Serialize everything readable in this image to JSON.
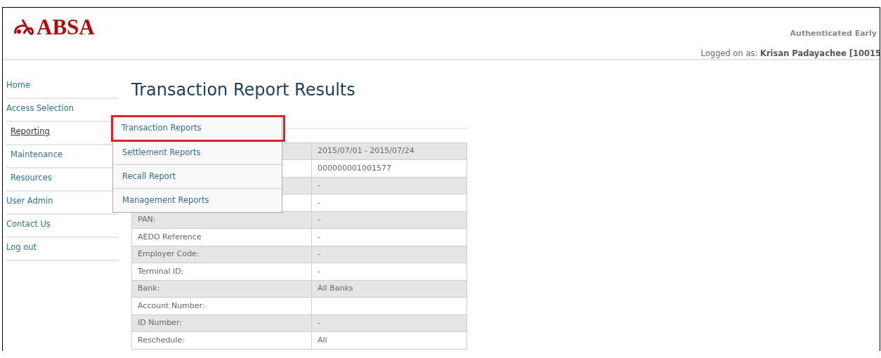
{
  "header": {
    "logo_text": "ABSA",
    "auth_status": "Authenticated Early",
    "logged_on_label": "Logged on as:",
    "user": "Krisan Padayachee [10015"
  },
  "sidebar": {
    "items": [
      {
        "label": "Home",
        "kind": "top",
        "selected": false
      },
      {
        "label": "Access Selection",
        "kind": "top",
        "selected": false
      },
      {
        "label": "Reporting",
        "kind": "sub",
        "selected": true
      },
      {
        "label": "Maintenance",
        "kind": "sub",
        "selected": false
      },
      {
        "label": "Resources",
        "kind": "sub",
        "selected": false
      },
      {
        "label": "User Admin",
        "kind": "top",
        "selected": false
      },
      {
        "label": "Contact Us",
        "kind": "top",
        "selected": false
      },
      {
        "label": "Log out",
        "kind": "top",
        "selected": false
      }
    ]
  },
  "page_title": "Transaction Report Results",
  "dropdown": {
    "items": [
      {
        "label": "Transaction Reports",
        "selected": true
      },
      {
        "label": "Settlement Reports",
        "selected": false
      },
      {
        "label": "Recall Report",
        "selected": false
      },
      {
        "label": "Management Reports",
        "selected": false
      }
    ]
  },
  "table": {
    "rows": [
      {
        "value": "2015/07/01 - 2015/07/24"
      },
      {
        "value": "000000001001577"
      },
      {
        "value": "-"
      },
      {
        "value": "-"
      },
      {
        "label": "PAN:",
        "value": "-"
      },
      {
        "label": "AEDO Reference",
        "value": "-"
      },
      {
        "label": "Employer Code:",
        "value": "-"
      },
      {
        "label": "Terminal ID:",
        "value": "-"
      },
      {
        "label": "Bank:",
        "value": "All Banks"
      },
      {
        "label": "Account Number:"
      },
      {
        "label": "ID Number:",
        "value": "-"
      },
      {
        "label": "Reschedule:",
        "value": "All"
      }
    ]
  }
}
